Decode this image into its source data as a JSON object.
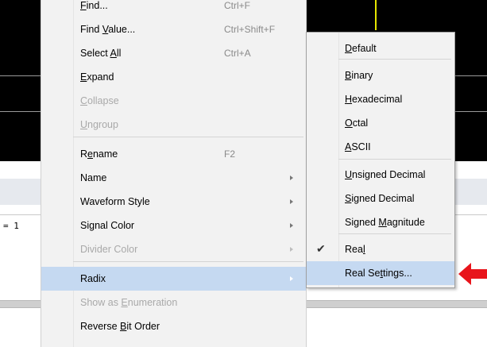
{
  "background": {
    "value_text": "= 1",
    "cursor_color": "#e6e600"
  },
  "menu": {
    "items": [
      {
        "pre": "",
        "u": "F",
        "post": "ind...",
        "accel": "Ctrl+F",
        "disabled": false,
        "submenu": false
      },
      {
        "pre": "Find ",
        "u": "V",
        "post": "alue...",
        "accel": "Ctrl+Shift+F",
        "disabled": false,
        "submenu": false
      },
      {
        "pre": "Select ",
        "u": "A",
        "post": "ll",
        "accel": "Ctrl+A",
        "disabled": false,
        "submenu": false
      },
      {
        "pre": "",
        "u": "E",
        "post": "xpand",
        "accel": "",
        "disabled": false,
        "submenu": false
      },
      {
        "pre": "",
        "u": "C",
        "post": "ollapse",
        "accel": "",
        "disabled": true,
        "submenu": false
      },
      {
        "pre": "",
        "u": "U",
        "post": "ngroup",
        "accel": "",
        "disabled": true,
        "submenu": false
      },
      {
        "pre": "R",
        "u": "e",
        "post": "name",
        "accel": "F2",
        "disabled": false,
        "submenu": false
      },
      {
        "pre": "Name",
        "u": "",
        "post": "",
        "accel": "",
        "disabled": false,
        "submenu": true
      },
      {
        "pre": "Waveform Style",
        "u": "",
        "post": "",
        "accel": "",
        "disabled": false,
        "submenu": true
      },
      {
        "pre": "Signal Color",
        "u": "",
        "post": "",
        "accel": "",
        "disabled": false,
        "submenu": true
      },
      {
        "pre": "Divider Color",
        "u": "",
        "post": "",
        "accel": "",
        "disabled": true,
        "submenu": true
      },
      {
        "pre": "Radix",
        "u": "",
        "post": "",
        "accel": "",
        "disabled": false,
        "submenu": true,
        "selected": true
      },
      {
        "pre": "Show as ",
        "u": "E",
        "post": "numeration",
        "accel": "",
        "disabled": true,
        "submenu": false
      },
      {
        "pre": "Reverse ",
        "u": "B",
        "post": "it Order",
        "accel": "",
        "disabled": false,
        "submenu": false
      }
    ]
  },
  "submenu": {
    "items": [
      {
        "pre": "",
        "u": "D",
        "post": "efault"
      },
      {
        "pre": "",
        "u": "B",
        "post": "inary"
      },
      {
        "pre": "",
        "u": "H",
        "post": "exadecimal"
      },
      {
        "pre": "",
        "u": "O",
        "post": "ctal"
      },
      {
        "pre": "",
        "u": "A",
        "post": "SCII"
      },
      {
        "pre": "",
        "u": "U",
        "post": "nsigned Decimal"
      },
      {
        "pre": "",
        "u": "S",
        "post": "igned Decimal"
      },
      {
        "pre": "Signed ",
        "u": "M",
        "post": "agnitude"
      },
      {
        "pre": "Rea",
        "u": "l",
        "post": "",
        "checked": true
      },
      {
        "pre": "Real Se",
        "u": "t",
        "post": "tings...",
        "selected": true
      }
    ]
  },
  "annotation": {
    "arrow_color": "#e8141b",
    "arrow_icon": "red-pointer-arrow-icon"
  }
}
